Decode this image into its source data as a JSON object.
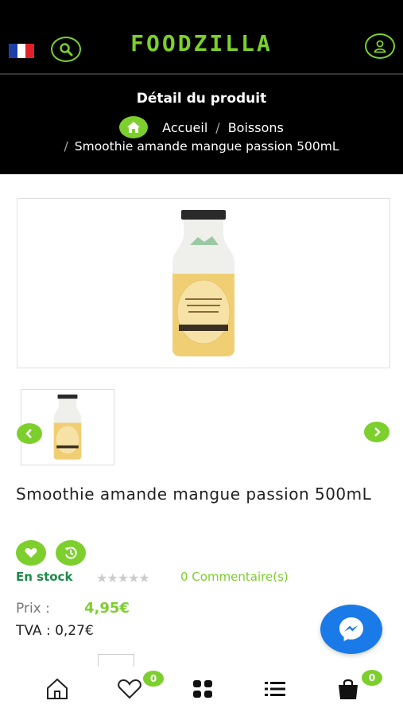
{
  "header": {
    "brand": "FOODZILLA",
    "page_title": "Détail du produit",
    "breadcrumb": {
      "home": "Accueil",
      "separator": "/",
      "category": "Boissons",
      "product": "Smoothie amande mangue passion 500mL"
    }
  },
  "product": {
    "name": "Smoothie amande mangue passion 500mL",
    "stock": "En stock",
    "rating_stars": "★★★★★",
    "rating": 0,
    "comments": "0 Commentaire(s)",
    "price_label": "Prix :",
    "price": "4,95€",
    "tva": "TVA : 0,27€"
  },
  "bottom_nav": {
    "favorites_count": "0",
    "cart_count": "0"
  },
  "colors": {
    "accent": "#7ccf2d",
    "header_bg": "#000000",
    "stock": "#1e8a4a",
    "messenger": "#1a7be8"
  }
}
